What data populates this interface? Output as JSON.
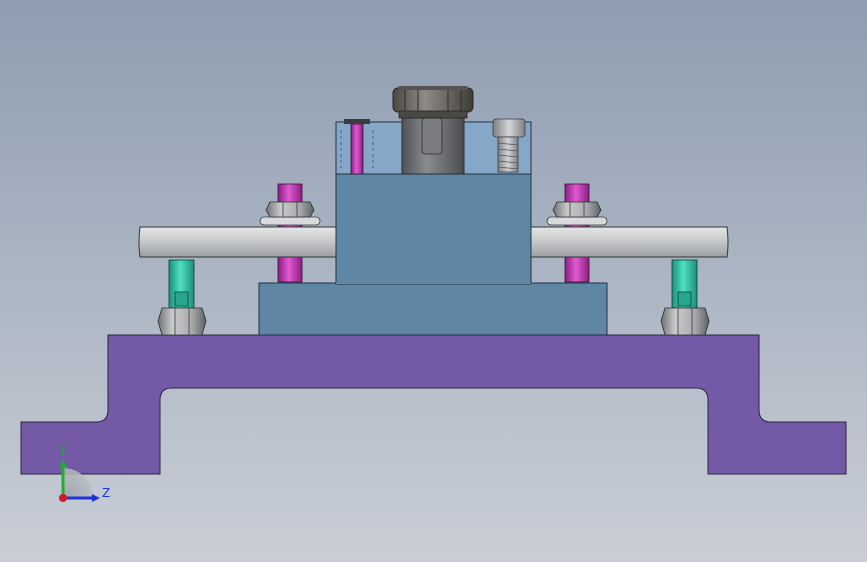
{
  "viewport": {
    "background_top": "#8e9db1",
    "background_bottom": "#c9ced6"
  },
  "triad": {
    "y_label": "Y",
    "z_label": "Z",
    "y_color": "#1fae2e",
    "z_color": "#1c36d6",
    "x_color": "#d0182a"
  },
  "colors": {
    "base_plate": "#7459a7",
    "riser_block": "#5f86a5",
    "top_block": "#86a8c8",
    "clamp_bar": "#c4c6c8",
    "magenta_post": "#c23bb3",
    "teal_post": "#2ec3a5",
    "hex_nut": "#a3a5a8",
    "knurled_nut": "#6b6762",
    "socket_screw": "#9ea1a6"
  }
}
